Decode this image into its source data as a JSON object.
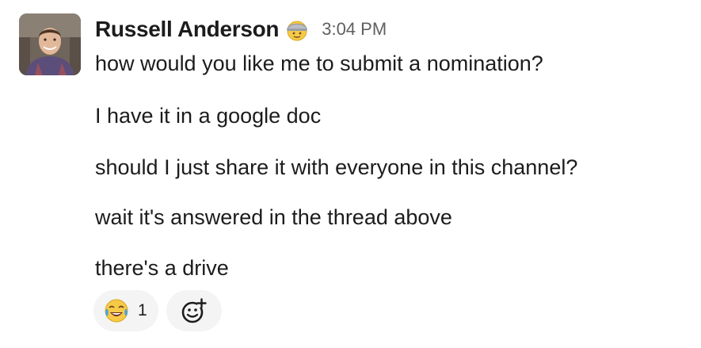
{
  "message": {
    "sender": "Russell Anderson",
    "status_emoji": "hard-hat-face-emoji",
    "timestamp": "3:04 PM",
    "lines": [
      "how would you like me to submit a nomination?",
      "I have it in a google doc",
      "should I just share it with everyone in this channel?",
      "wait it's answered in the thread above",
      "there's a drive"
    ]
  },
  "reactions": [
    {
      "emoji": "joy-emoji",
      "count": "1"
    }
  ],
  "add_reaction_icon": "add-emoji-icon",
  "colors": {
    "text": "#1d1c1d",
    "timestamp": "#616061",
    "pill_background": "#f4f4f4"
  }
}
